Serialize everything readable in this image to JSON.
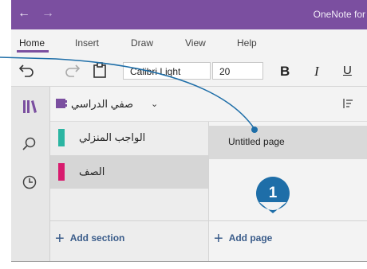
{
  "titlebar": {
    "title": "OneNote for",
    "back_icon": "←",
    "forward_icon": "→"
  },
  "menu": {
    "items": [
      "Home",
      "Insert",
      "Draw",
      "View",
      "Help"
    ],
    "active": "Home"
  },
  "toolbar": {
    "font": "Calibri Light",
    "size": "20",
    "bold": "B",
    "italic": "I",
    "underline": "U"
  },
  "notebook": {
    "name": "صفي الدراسي",
    "chevron": "⌄"
  },
  "sections": [
    {
      "label": "الواجب المنزلي",
      "color": "#2bb5a2"
    },
    {
      "label": "الصف",
      "color": "#d81b6e"
    }
  ],
  "pages": [
    {
      "label": "Untitled page"
    }
  ],
  "add_section": "Add section",
  "add_page": "Add page",
  "callout": {
    "number": "1",
    "color": "#1e6ea8"
  },
  "colors": {
    "accent": "#7b4fa0"
  }
}
